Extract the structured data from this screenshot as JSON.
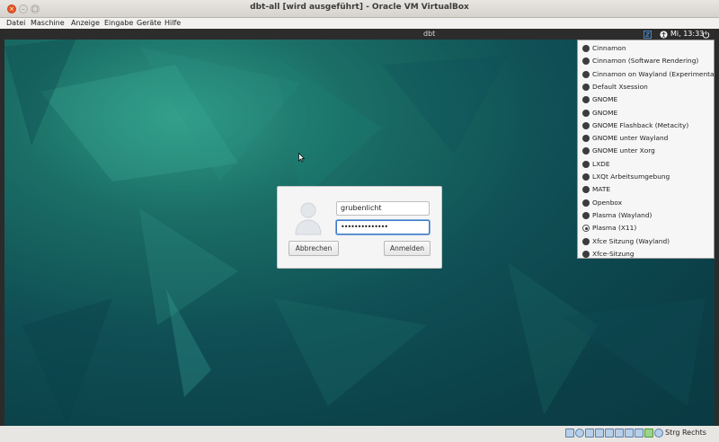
{
  "window": {
    "title": "dbt-all [wird ausgeführt] - Oracle VM VirtualBox",
    "close_glyph": "×",
    "min_glyph": "–",
    "max_glyph": "□"
  },
  "menubar": [
    "Datei",
    "Maschine",
    "Anzeige",
    "Eingabe",
    "Geräte",
    "Hilfe"
  ],
  "guest": {
    "panel": {
      "hostname": "dbt",
      "clock": "Mi, 13:33"
    },
    "sessions": [
      {
        "label": "Cinnamon",
        "selected": false
      },
      {
        "label": "Cinnamon (Software Rendering)",
        "selected": false
      },
      {
        "label": "Cinnamon on Wayland (Experimental)",
        "selected": false
      },
      {
        "label": "Default Xsession",
        "selected": false
      },
      {
        "label": "GNOME",
        "selected": false
      },
      {
        "label": "GNOME",
        "selected": false
      },
      {
        "label": "GNOME Flashback (Metacity)",
        "selected": false
      },
      {
        "label": "GNOME unter Wayland",
        "selected": false
      },
      {
        "label": "GNOME unter Xorg",
        "selected": false
      },
      {
        "label": "LXDE",
        "selected": false
      },
      {
        "label": "LXQt Arbeitsumgebung",
        "selected": false
      },
      {
        "label": "MATE",
        "selected": false
      },
      {
        "label": "Openbox",
        "selected": false
      },
      {
        "label": "Plasma (Wayland)",
        "selected": false
      },
      {
        "label": "Plasma (X11)",
        "selected": true
      },
      {
        "label": "Xfce Sitzung (Wayland)",
        "selected": false
      },
      {
        "label": "Xfce-Sitzung",
        "selected": false
      }
    ],
    "login": {
      "username": "grubenlicht",
      "password_mask": "••••••••••••••",
      "cancel_label": "Abbrechen",
      "login_label": "Anmelden"
    }
  },
  "statusbar": {
    "host_key": "Strg Rechts"
  }
}
